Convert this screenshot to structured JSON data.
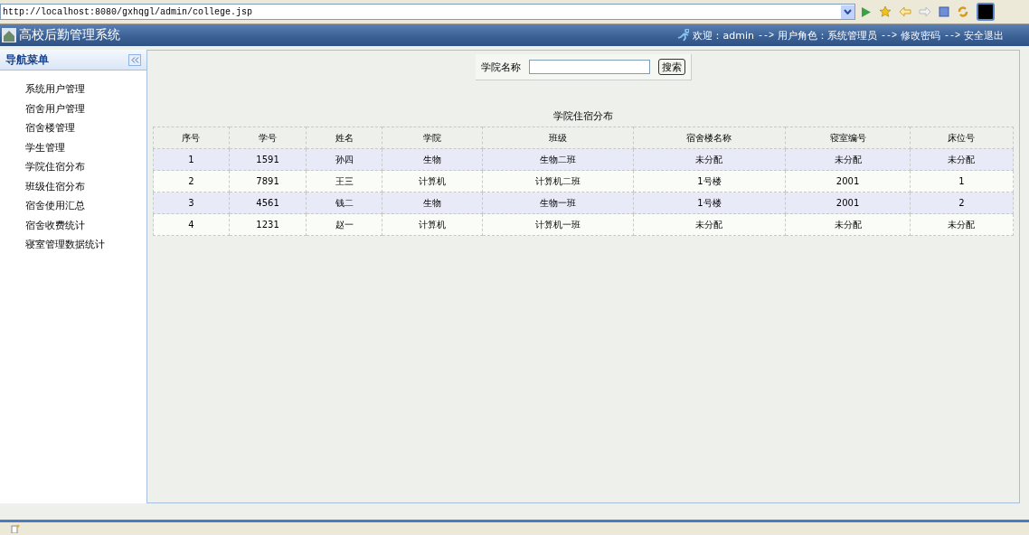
{
  "browser": {
    "url": "http://localhost:8080/gxhqgl/admin/college.jsp"
  },
  "header": {
    "title": "高校后勤管理系统",
    "user_info": [
      {
        "kind": "text",
        "text": "欢迎：admin"
      },
      {
        "kind": "separator",
        "text": "-->"
      },
      {
        "kind": "text",
        "text": "用户角色：系统管理员"
      },
      {
        "kind": "separator",
        "text": "-->"
      },
      {
        "kind": "link",
        "text": "修改密码"
      },
      {
        "kind": "separator",
        "text": "-->"
      },
      {
        "kind": "link",
        "text": "安全退出"
      }
    ]
  },
  "sidebar": {
    "title": "导航菜单",
    "items": [
      {
        "label": "系统用户管理"
      },
      {
        "label": "宿舍用户管理"
      },
      {
        "label": "宿舍楼管理"
      },
      {
        "label": "学生管理"
      },
      {
        "label": "学院住宿分布"
      },
      {
        "label": "班级住宿分布"
      },
      {
        "label": "宿舍使用汇总"
      },
      {
        "label": "宿舍收费统计"
      },
      {
        "label": "寝室管理数据统计"
      }
    ]
  },
  "search": {
    "label": "学院名称",
    "button": "搜索"
  },
  "table": {
    "title": "学院住宿分布",
    "columns": [
      "序号",
      "学号",
      "姓名",
      "学院",
      "班级",
      "宿舍楼名称",
      "寝室编号",
      "床位号"
    ],
    "rows": [
      [
        "1",
        "1591",
        "孙四",
        "生物",
        "生物二班",
        "未分配",
        "未分配",
        "未分配"
      ],
      [
        "2",
        "7891",
        "王三",
        "计算机",
        "计算机二班",
        "1号楼",
        "2001",
        "1"
      ],
      [
        "3",
        "4561",
        "钱二",
        "生物",
        "生物一班",
        "1号楼",
        "2001",
        "2"
      ],
      [
        "4",
        "1231",
        "赵一",
        "计算机",
        "计算机一班",
        "未分配",
        "未分配",
        "未分配"
      ]
    ]
  }
}
